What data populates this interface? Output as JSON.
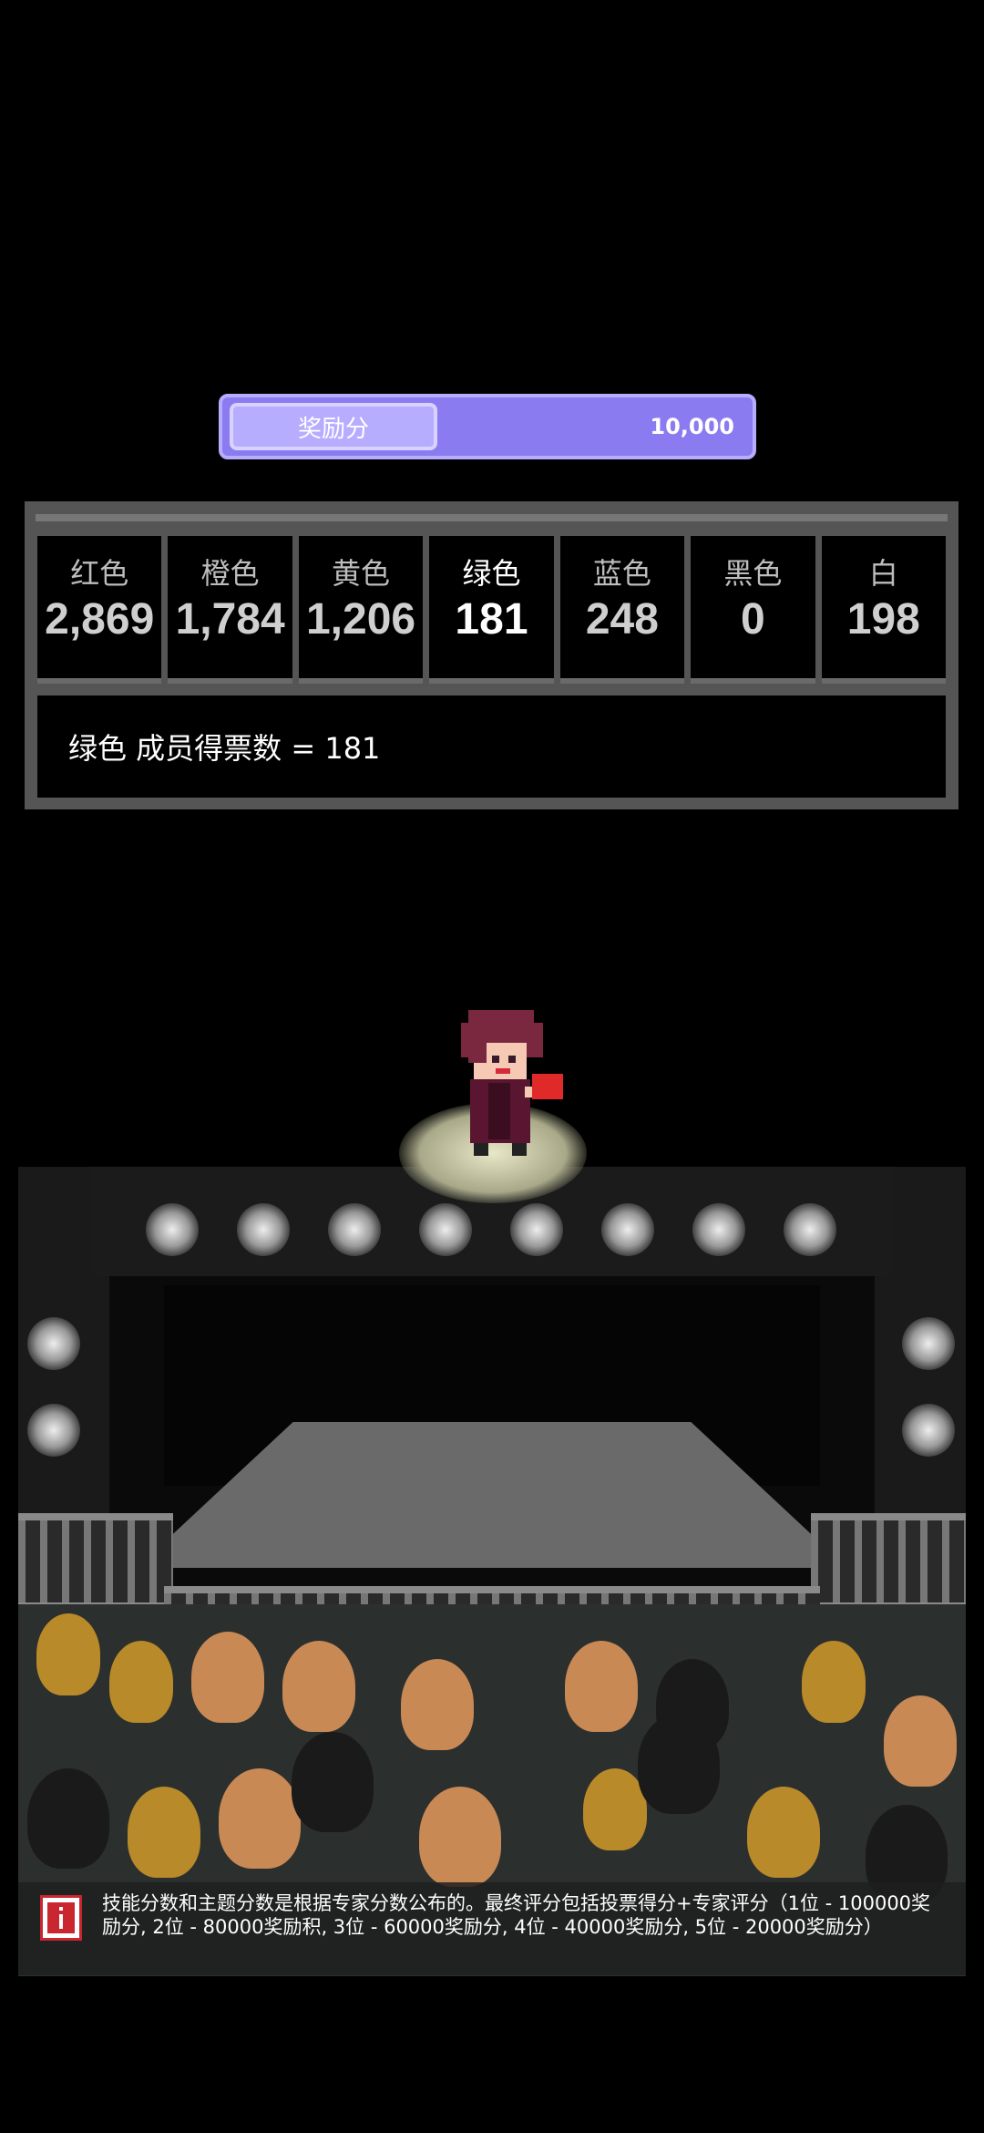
{
  "reward": {
    "label": "奖励分",
    "value": "10,000"
  },
  "votes": [
    {
      "name": "红色",
      "count": "2,869"
    },
    {
      "name": "橙色",
      "count": "1,784"
    },
    {
      "name": "黄色",
      "count": "1,206"
    },
    {
      "name": "绿色",
      "count": "181",
      "active": true
    },
    {
      "name": "蓝色",
      "count": "248"
    },
    {
      "name": "黑色",
      "count": "0"
    },
    {
      "name": "白",
      "count": "198"
    }
  ],
  "summary": "绿色 成员得票数 = 181",
  "hint": {
    "icon": "info-icon",
    "text": "技能分数和主题分数是根据专家分数公布的。最终评分包括投票得分+专家评分（1位 - 100000奖励分, 2位 - 80000奖励积, 3位 - 60000奖励分, 4位 - 40000奖励分, 5位 - 20000奖励分）"
  },
  "colors": {
    "reward_bar": "#8a7cf0",
    "reward_label_bg": "#b7adff",
    "panel": "#555555",
    "info_red": "#c9262f"
  }
}
